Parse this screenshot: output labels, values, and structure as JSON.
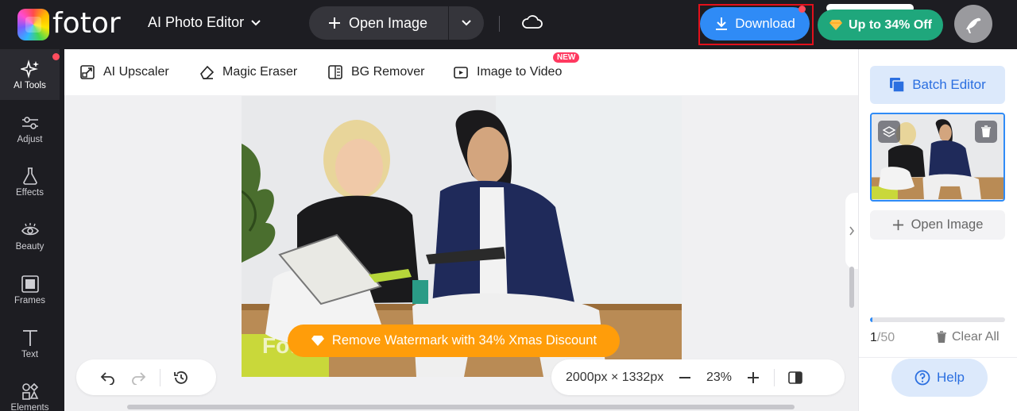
{
  "app": {
    "brand": "fotor",
    "editor_menu": "AI Photo Editor"
  },
  "topbar": {
    "open_image": "Open Image",
    "download": "Download",
    "promo": "Up to 34% Off"
  },
  "sidebar": {
    "items": [
      {
        "label": "AI Tools",
        "icon": "sparkle-icon"
      },
      {
        "label": "Adjust",
        "icon": "sliders-icon"
      },
      {
        "label": "Effects",
        "icon": "flask-icon"
      },
      {
        "label": "Beauty",
        "icon": "eye-icon"
      },
      {
        "label": "Frames",
        "icon": "frame-icon"
      },
      {
        "label": "Text",
        "icon": "text-icon"
      },
      {
        "label": "Elements",
        "icon": "shapes-icon"
      }
    ]
  },
  "tools": {
    "upscaler": "AI Upscaler",
    "eraser": "Magic Eraser",
    "bg_remover": "BG Remover",
    "image_to_video": "Image to Video",
    "new_badge": "NEW"
  },
  "canvas": {
    "watermark_text": "Fot",
    "watermark_banner": "Remove Watermark with 34% Xmas Discount",
    "dimensions": "2000px × 1332px",
    "zoom": "23%"
  },
  "panel": {
    "batch_editor": "Batch Editor",
    "open_image": "Open Image",
    "count_current": "1",
    "count_total": "/50",
    "count_progress": 0.02,
    "clear_all": "Clear All",
    "help": "Help"
  },
  "colors": {
    "accent": "#2f8bf6",
    "promo": "#1fa77c",
    "watermark": "#ff9d0a",
    "alert": "#e3101b"
  }
}
